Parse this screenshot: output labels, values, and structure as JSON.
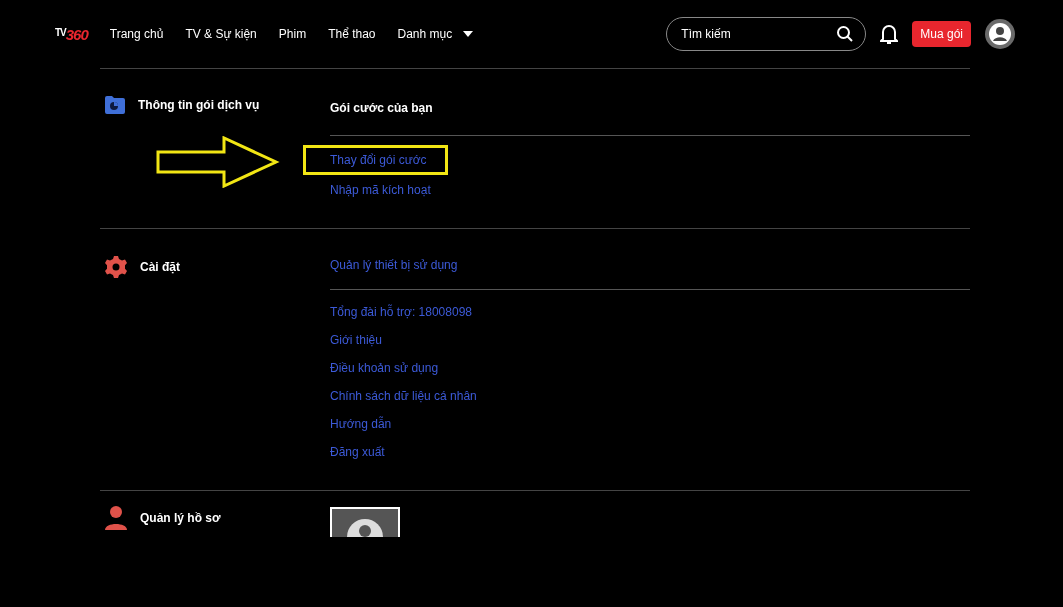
{
  "nav": {
    "logo": {
      "prefix": "TV",
      "suffix": "360"
    },
    "links": [
      {
        "label": "Trang chủ",
        "dropdown": false
      },
      {
        "label": "TV & Sự kiện",
        "dropdown": false
      },
      {
        "label": "Phim",
        "dropdown": false
      },
      {
        "label": "Thể thao",
        "dropdown": false
      },
      {
        "label": "Danh mục",
        "dropdown": true
      }
    ],
    "search": {
      "placeholder": "Tìm kiếm"
    },
    "buy_button": "Mua gói"
  },
  "sections": [
    {
      "title": "Thông tin gói dịch vụ",
      "groups": [
        [
          {
            "kind": "heading",
            "label": "Gói cước của bạn"
          }
        ],
        [
          {
            "kind": "link",
            "label": "Thay đổi gói cước",
            "highlighted": true
          },
          {
            "kind": "link",
            "label": "Nhập mã kích hoạt",
            "highlighted": false
          }
        ]
      ]
    },
    {
      "title": "Cài đặt",
      "groups": [
        [
          {
            "kind": "link",
            "label": "Quản lý thiết bị sử dụng",
            "highlighted": false
          }
        ],
        [
          {
            "kind": "link",
            "label": "Tổng đài hỗ trợ: 18008098",
            "highlighted": false
          },
          {
            "kind": "link",
            "label": "Giới thiệu",
            "highlighted": false
          },
          {
            "kind": "link",
            "label": "Điều khoản sử dụng",
            "highlighted": false
          },
          {
            "kind": "link",
            "label": "Chính sách dữ liệu cá nhân",
            "highlighted": false
          },
          {
            "kind": "link",
            "label": "Hướng dẫn",
            "highlighted": false
          },
          {
            "kind": "link",
            "label": "Đăng xuất",
            "highlighted": false
          }
        ]
      ]
    },
    {
      "title": "Quản lý hồ sơ",
      "groups": [
        [
          {
            "kind": "avatar"
          }
        ]
      ]
    }
  ]
}
